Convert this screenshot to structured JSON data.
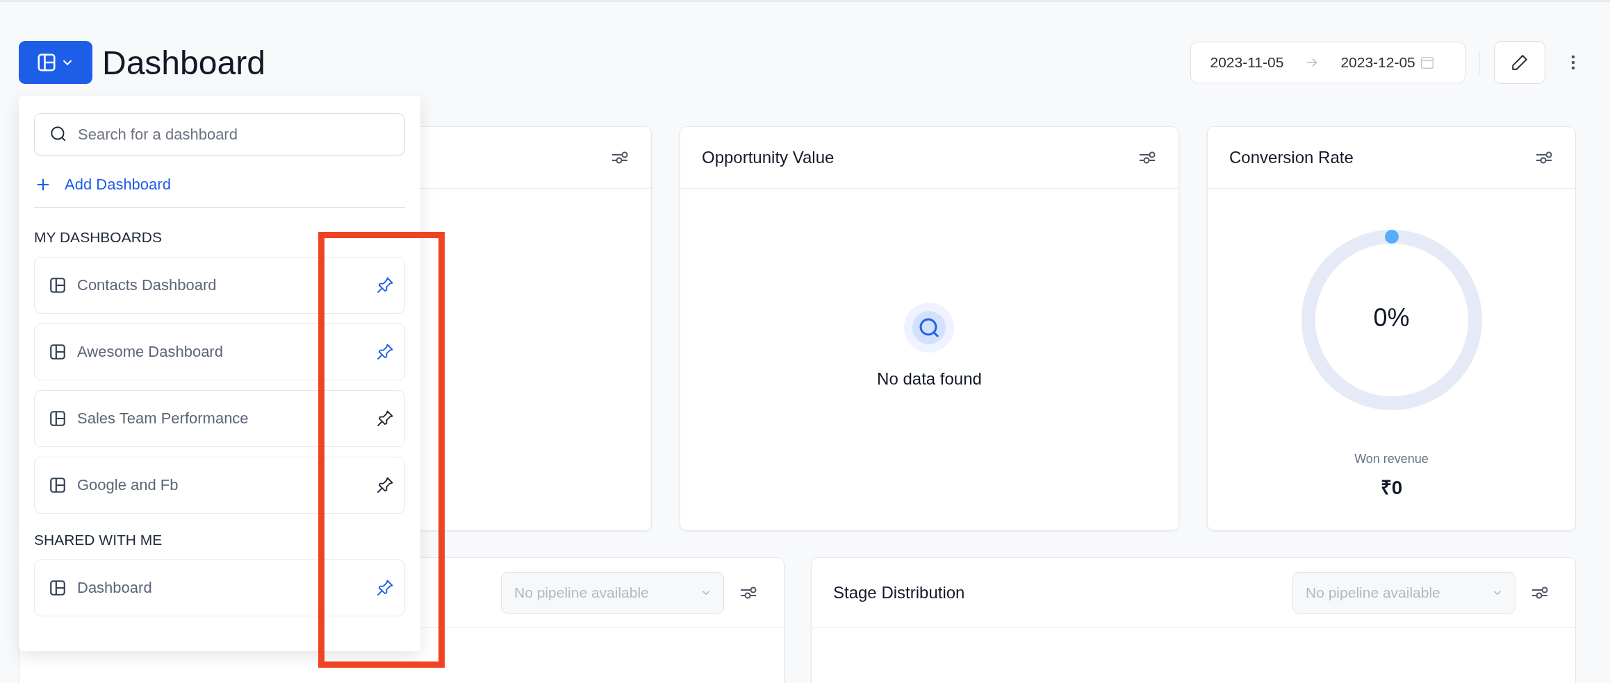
{
  "header": {
    "title": "Dashboard",
    "date_range": {
      "start": "2023-11-05",
      "end": "2023-12-05"
    }
  },
  "dashboard_menu": {
    "search": {
      "placeholder": "Search for a dashboard"
    },
    "add_label": "Add Dashboard",
    "sections": [
      {
        "heading": "MY DASHBOARDS",
        "items": [
          {
            "name": "Contacts Dashboard",
            "pinned": true
          },
          {
            "name": "Awesome Dashboard",
            "pinned": true
          },
          {
            "name": "Sales Team Performance",
            "pinned": false
          },
          {
            "name": "Google and Fb",
            "pinned": false
          }
        ]
      },
      {
        "heading": "SHARED WITH ME",
        "items": [
          {
            "name": "Dashboard",
            "pinned": true
          }
        ]
      }
    ]
  },
  "top_widgets": [
    {
      "kind": "covered"
    },
    {
      "kind": "empty",
      "title": "Opportunity Value",
      "message": "No data found"
    },
    {
      "kind": "gauge",
      "title": "Conversion Rate",
      "reading": "0%",
      "level": 0,
      "caption": "Won revenue",
      "value": "₹0"
    }
  ],
  "bottom_widgets": [
    {
      "kind": "pipeline",
      "select": {
        "placeholder": "No pipeline available",
        "disabled": true
      }
    },
    {
      "kind": "pipeline",
      "title": "Stage Distribution",
      "select": {
        "placeholder": "No pipeline available",
        "disabled": true
      }
    }
  ]
}
